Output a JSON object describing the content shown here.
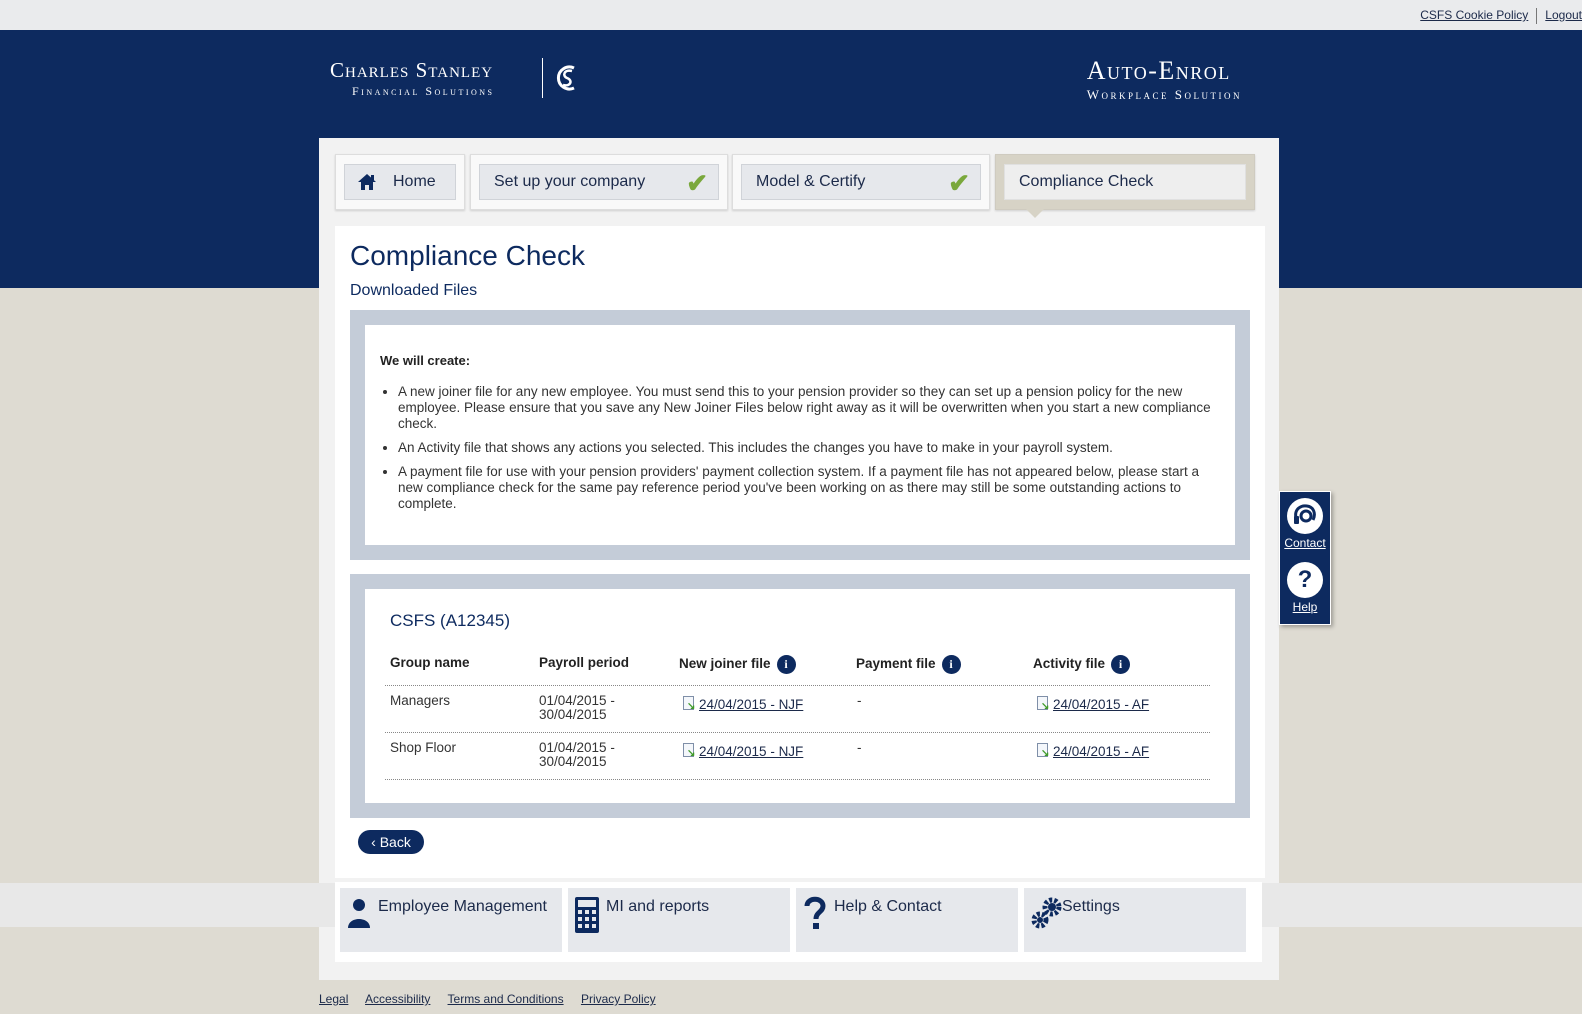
{
  "topbar": {
    "cookie_policy": "CSFS Cookie Policy",
    "logout": "Logout"
  },
  "logos": {
    "cs_line1": "Charles Stanley",
    "cs_line2": "Financial Solutions",
    "cs_mark": "CS",
    "ae_line1": "Auto-Enrol",
    "ae_line2": "Workplace Solution"
  },
  "tabs": [
    {
      "label": "Home",
      "icon": "home-icon"
    },
    {
      "label": "Set up your company",
      "complete": true
    },
    {
      "label": "Model & Certify",
      "complete": true
    },
    {
      "label": "Compliance Check",
      "active": true
    }
  ],
  "check_glyph": "✔",
  "page": {
    "title": "Compliance Check",
    "subtitle": "Downloaded Files"
  },
  "info_box": {
    "heading": "We will create:",
    "items": [
      "A new joiner file for any new employee. You must send this to your pension provider so they can set up a pension policy for the new employee. Please ensure that you save any New Joiner Files below right away as it will be overwritten when you start a new compliance check.",
      "An Activity file that shows any actions you selected. This includes the changes you have to make in your payroll system.",
      "A payment file for use with your pension providers' payment collection system. If a payment file has not appeared below, please start a new compliance check for the same pay reference period you've been working on as there may still be some outstanding actions to complete."
    ]
  },
  "files": {
    "company": "CSFS (A12345)",
    "info_glyph": "i",
    "columns": [
      "Group name",
      "Payroll period",
      "New joiner file",
      "Payment file",
      "Activity file"
    ],
    "rows": [
      {
        "group": "Managers",
        "period_start": "01/04/2015 -",
        "period_end": "30/04/2015",
        "new_joiner": "24/04/2015 - NJF",
        "payment": "-",
        "activity": "24/04/2015 - AF"
      },
      {
        "group": "Shop Floor",
        "period_start": "01/04/2015 -",
        "period_end": "30/04/2015",
        "new_joiner": "24/04/2015 - NJF",
        "payment": "-",
        "activity": "24/04/2015 - AF"
      }
    ]
  },
  "back_button": "‹ Back",
  "bottom_nav": [
    {
      "label": "Employee Management",
      "icon": "person-icon"
    },
    {
      "label": "MI and reports",
      "icon": "calculator-icon"
    },
    {
      "label": "Help & Contact",
      "icon": "question-icon"
    },
    {
      "label": "Settings",
      "icon": "gears-icon"
    }
  ],
  "side_widget": {
    "contact": "Contact",
    "help": "Help",
    "help_glyph": "?"
  },
  "footer": [
    "Legal",
    "Accessibility",
    "Terms and Conditions",
    "Privacy Policy"
  ],
  "colors": {
    "navy": "#0d2a5f",
    "check_green": "#7aa83c",
    "page_bg": "#dedbd2"
  }
}
